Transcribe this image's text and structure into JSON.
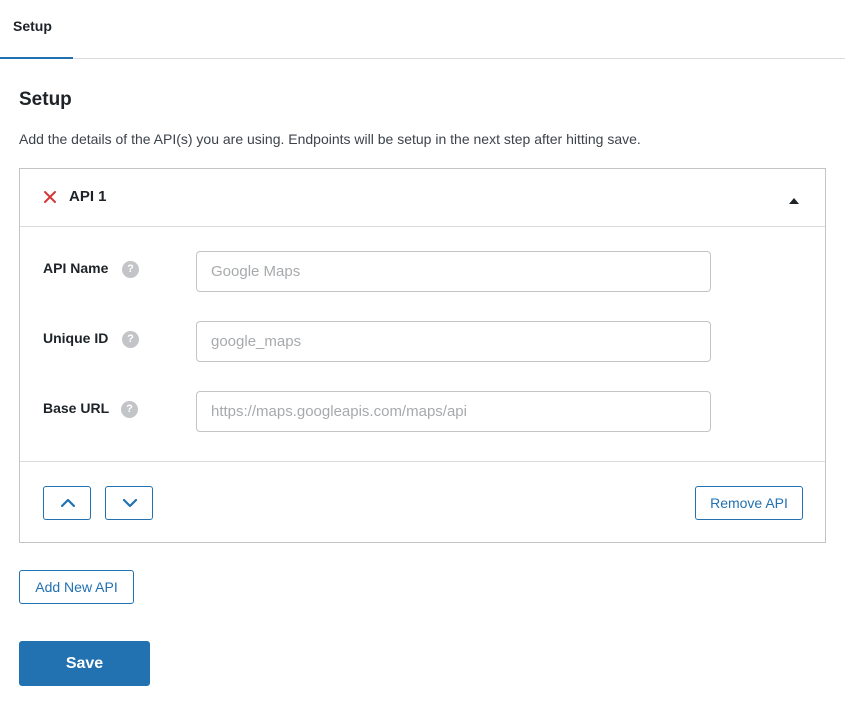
{
  "tabs": [
    {
      "label": "Setup",
      "active": true
    }
  ],
  "page": {
    "title": "Setup",
    "description": "Add the details of the API(s) you are using. Endpoints will be setup in the next step after hitting save."
  },
  "api": {
    "title": "API 1",
    "remove_icon": "close-icon",
    "collapse_icon": "caret-up-icon",
    "fields": [
      {
        "label": "API Name",
        "placeholder": "Google Maps",
        "value": "",
        "help_icon": "help-icon"
      },
      {
        "label": "Unique ID",
        "placeholder": "google_maps",
        "value": "",
        "help_icon": "help-icon"
      },
      {
        "label": "Base URL",
        "placeholder": "https://maps.googleapis.com/maps/api",
        "value": "",
        "help_icon": "help-icon"
      }
    ],
    "help_glyph": "?",
    "move_up_icon": "chevron-up-icon",
    "move_down_icon": "chevron-down-icon",
    "remove_label": "Remove API"
  },
  "actions": {
    "add_label": "Add New API",
    "save_label": "Save"
  },
  "colors": {
    "accent": "#2271b1",
    "danger": "#d63638",
    "border": "#c3c4c7"
  }
}
